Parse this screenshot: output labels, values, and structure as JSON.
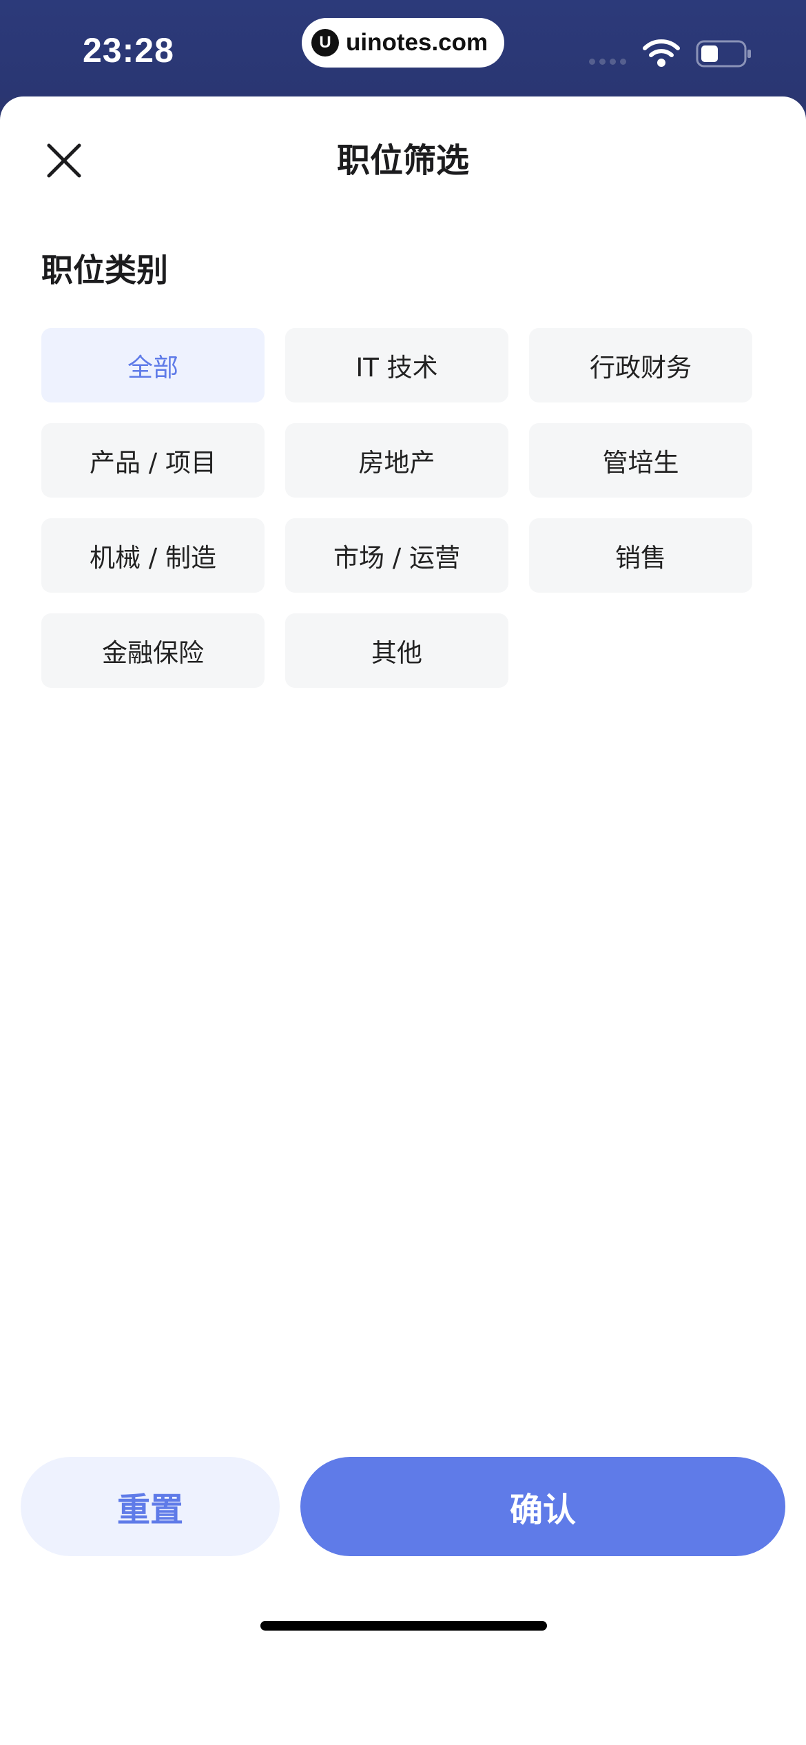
{
  "status_bar": {
    "time": "23:28",
    "url": "uinotes.com",
    "logo_letter": "U",
    "icons": [
      "signal-icon",
      "wifi-icon",
      "battery-icon"
    ]
  },
  "sheet": {
    "title": "职位筛选",
    "close_icon": "close-icon",
    "section_title": "职位类别",
    "categories": [
      {
        "label": "全部",
        "selected": true
      },
      {
        "label": "IT 技术",
        "selected": false
      },
      {
        "label": "行政财务",
        "selected": false
      },
      {
        "label": "产品 / 项目",
        "selected": false
      },
      {
        "label": "房地产",
        "selected": false
      },
      {
        "label": "管培生",
        "selected": false
      },
      {
        "label": "机械 / 制造",
        "selected": false
      },
      {
        "label": "市场 / 运营",
        "selected": false
      },
      {
        "label": "销售",
        "selected": false
      },
      {
        "label": "金融保险",
        "selected": false
      },
      {
        "label": "其他",
        "selected": false
      }
    ]
  },
  "footer": {
    "reset_label": "重置",
    "confirm_label": "确认"
  },
  "colors": {
    "accent": "#5f7be8",
    "accent_light": "#eef2fe",
    "chip_bg": "#f5f6f7",
    "header_bg": "#2b3670"
  }
}
